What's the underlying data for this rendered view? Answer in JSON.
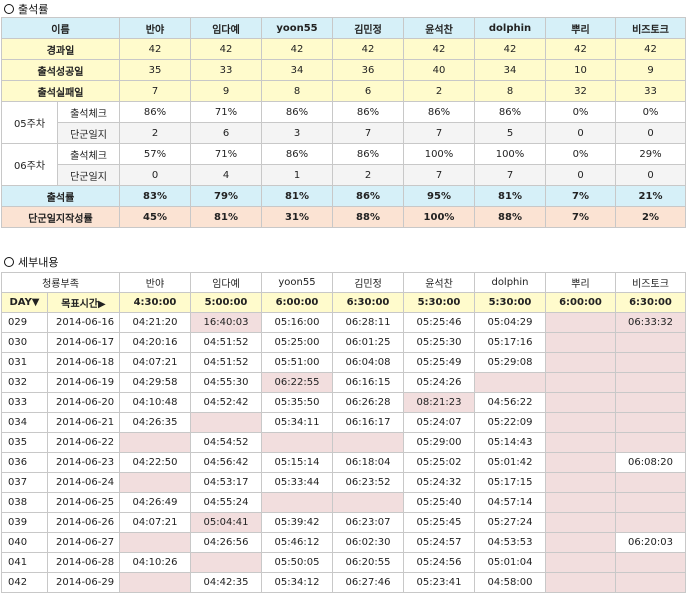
{
  "section1": {
    "title": "출석률"
  },
  "section2": {
    "title": "세부내용"
  },
  "members": [
    "반야",
    "임다예",
    "yoon55",
    "김민정",
    "윤석찬",
    "dolphin",
    "뿌리",
    "비즈토크"
  ],
  "summary": {
    "name_header": "이름",
    "rows": [
      {
        "label": "경과일",
        "values": [
          "42",
          "42",
          "42",
          "42",
          "42",
          "42",
          "42",
          "42"
        ]
      },
      {
        "label": "출석성공일",
        "values": [
          "35",
          "33",
          "34",
          "36",
          "40",
          "34",
          "10",
          "9"
        ]
      },
      {
        "label": "출석실패일",
        "values": [
          "7",
          "9",
          "8",
          "6",
          "2",
          "8",
          "32",
          "33"
        ]
      }
    ],
    "weeks": [
      {
        "week": "05주차",
        "check_label": "출석체크",
        "check": [
          "86%",
          "71%",
          "86%",
          "86%",
          "86%",
          "86%",
          "0%",
          "0%"
        ],
        "diary_label": "단군일지",
        "diary": [
          "2",
          "6",
          "3",
          "7",
          "7",
          "5",
          "0",
          "0"
        ]
      },
      {
        "week": "06주차",
        "check_label": "출석체크",
        "check": [
          "57%",
          "71%",
          "86%",
          "86%",
          "100%",
          "100%",
          "0%",
          "29%"
        ],
        "diary_label": "단군일지",
        "diary": [
          "0",
          "4",
          "1",
          "2",
          "7",
          "7",
          "0",
          "0"
        ]
      }
    ],
    "rate": {
      "label": "출석률",
      "values": [
        "83%",
        "79%",
        "81%",
        "86%",
        "95%",
        "81%",
        "7%",
        "21%"
      ]
    },
    "diary_rate": {
      "label": "단군일지작성률",
      "values": [
        "45%",
        "81%",
        "31%",
        "88%",
        "100%",
        "88%",
        "7%",
        "2%"
      ]
    }
  },
  "detail": {
    "tribe_label": "청룡부족",
    "day_label": "DAY▼",
    "target_label": "목표시간▶",
    "targets": [
      "4:30:00",
      "5:00:00",
      "6:00:00",
      "6:30:00",
      "5:30:00",
      "5:30:00",
      "6:00:00",
      "6:30:00"
    ],
    "rows": [
      {
        "day": "029",
        "date": "2014-06-16",
        "times": [
          "04:21:20",
          "16:40:03",
          "05:16:00",
          "06:28:11",
          "05:25:46",
          "05:04:29",
          "",
          "06:33:32"
        ],
        "late": [
          false,
          true,
          false,
          false,
          false,
          false,
          true,
          true
        ]
      },
      {
        "day": "030",
        "date": "2014-06-17",
        "times": [
          "04:20:16",
          "04:51:52",
          "05:25:00",
          "06:01:25",
          "05:25:30",
          "05:17:16",
          "",
          ""
        ],
        "late": [
          false,
          false,
          false,
          false,
          false,
          false,
          true,
          true
        ]
      },
      {
        "day": "031",
        "date": "2014-06-18",
        "times": [
          "04:07:21",
          "04:51:52",
          "05:51:00",
          "06:04:08",
          "05:25:49",
          "05:29:08",
          "",
          ""
        ],
        "late": [
          false,
          false,
          false,
          false,
          false,
          false,
          true,
          true
        ]
      },
      {
        "day": "032",
        "date": "2014-06-19",
        "times": [
          "04:29:58",
          "04:55:30",
          "06:22:55",
          "06:16:15",
          "05:24:26",
          "",
          "",
          ""
        ],
        "late": [
          false,
          false,
          true,
          false,
          false,
          true,
          true,
          true
        ]
      },
      {
        "day": "033",
        "date": "2014-06-20",
        "times": [
          "04:10:48",
          "04:52:42",
          "05:35:50",
          "06:26:28",
          "08:21:23",
          "04:56:22",
          "",
          ""
        ],
        "late": [
          false,
          false,
          false,
          false,
          true,
          false,
          true,
          true
        ]
      },
      {
        "day": "034",
        "date": "2014-06-21",
        "times": [
          "04:26:35",
          "",
          "05:34:11",
          "06:16:17",
          "05:24:07",
          "05:22:09",
          "",
          ""
        ],
        "late": [
          false,
          true,
          false,
          false,
          false,
          false,
          true,
          true
        ]
      },
      {
        "day": "035",
        "date": "2014-06-22",
        "times": [
          "",
          "04:54:52",
          "",
          "",
          "05:29:00",
          "05:14:43",
          "",
          ""
        ],
        "late": [
          true,
          false,
          true,
          true,
          false,
          false,
          true,
          true
        ]
      },
      {
        "day": "036",
        "date": "2014-06-23",
        "times": [
          "04:22:50",
          "04:56:42",
          "05:15:14",
          "06:18:04",
          "05:25:02",
          "05:01:42",
          "",
          "06:08:20"
        ],
        "late": [
          false,
          false,
          false,
          false,
          false,
          false,
          true,
          false
        ]
      },
      {
        "day": "037",
        "date": "2014-06-24",
        "times": [
          "",
          "04:53:17",
          "05:33:44",
          "06:23:52",
          "05:24:32",
          "05:17:15",
          "",
          ""
        ],
        "late": [
          true,
          false,
          false,
          false,
          false,
          false,
          true,
          true
        ]
      },
      {
        "day": "038",
        "date": "2014-06-25",
        "times": [
          "04:26:49",
          "04:55:24",
          "",
          "",
          "05:25:40",
          "04:57:14",
          "",
          ""
        ],
        "late": [
          false,
          false,
          true,
          true,
          false,
          false,
          true,
          true
        ]
      },
      {
        "day": "039",
        "date": "2014-06-26",
        "times": [
          "04:07:21",
          "05:04:41",
          "05:39:42",
          "06:23:07",
          "05:25:45",
          "05:27:24",
          "",
          ""
        ],
        "late": [
          false,
          true,
          false,
          false,
          false,
          false,
          true,
          true
        ]
      },
      {
        "day": "040",
        "date": "2014-06-27",
        "times": [
          "",
          "04:26:56",
          "05:46:12",
          "06:02:30",
          "05:24:57",
          "04:53:53",
          "",
          "06:20:03"
        ],
        "late": [
          true,
          false,
          false,
          false,
          false,
          false,
          true,
          false
        ]
      },
      {
        "day": "041",
        "date": "2014-06-28",
        "times": [
          "04:10:26",
          "",
          "05:50:05",
          "06:20:55",
          "05:24:56",
          "05:01:04",
          "",
          ""
        ],
        "late": [
          false,
          true,
          false,
          false,
          false,
          false,
          true,
          true
        ]
      },
      {
        "day": "042",
        "date": "2014-06-29",
        "times": [
          "",
          "04:42:35",
          "05:34:12",
          "06:27:46",
          "05:23:41",
          "04:58:00",
          "",
          ""
        ],
        "late": [
          true,
          false,
          false,
          false,
          false,
          false,
          true,
          true
        ]
      }
    ]
  }
}
